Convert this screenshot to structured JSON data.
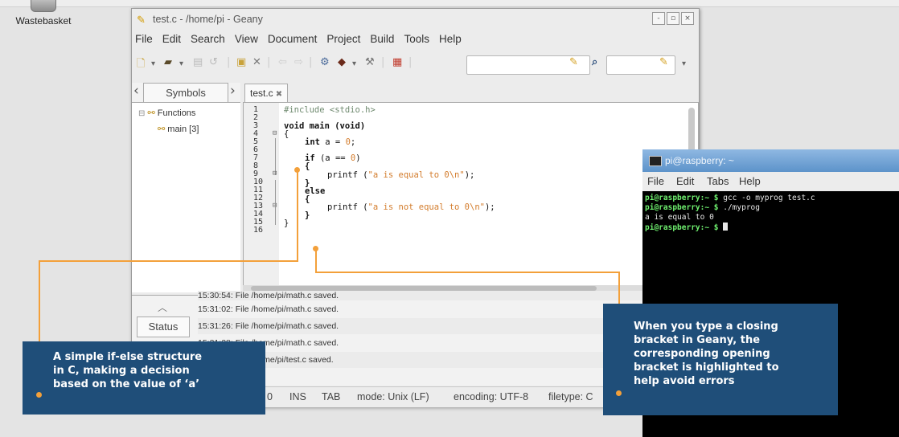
{
  "desktop": {
    "wastebasket_label": "Wastebasket"
  },
  "geany": {
    "title": "test.c - /home/pi - Geany",
    "window_buttons": [
      "-",
      "▫",
      "×"
    ],
    "menu": [
      "File",
      "Edit",
      "Search",
      "View",
      "Document",
      "Project",
      "Build",
      "Tools",
      "Help"
    ],
    "symbols_tab": "Symbols",
    "symbols_tree": {
      "group": "Functions",
      "item": "main [3]"
    },
    "editor_tab": "test.c",
    "editor_tab_close": "✖",
    "line_numbers": [
      "1",
      "2",
      "3",
      "4",
      "5",
      "6",
      "7",
      "8",
      "9",
      "10",
      "11",
      "12",
      "13",
      "14",
      "15",
      "16"
    ],
    "code": {
      "l1": "#include <stdio.h>",
      "l3": "void main (void)",
      "l4": "{",
      "l5_kw": "int",
      "l5_rest": " a = ",
      "l5_num": "0",
      "l5_end": ";",
      "l7_kw": "if",
      "l7_rest": " (a == ",
      "l7_num": "0",
      "l7_end": ")",
      "l8": "{",
      "l9_fn": "printf (",
      "l9_str": "\"a is equal to 0\\n\"",
      "l9_end": ");",
      "l10": "}",
      "l11": "else",
      "l12": "{",
      "l13_fn": "printf (",
      "l13_str": "\"a is not equal to 0\\n\"",
      "l13_end": ");",
      "l14": "}",
      "l15": "}"
    },
    "status_tab": "Status",
    "messages": [
      "15:30:54: File /home/pi/math.c saved.",
      "15:31:02: File /home/pi/math.c saved.",
      "15:31:26: File /home/pi/math.c saved.",
      "15:31:28: File /home/pi/math.c saved.",
      "15:31:33: File /home/pi/test.c saved."
    ],
    "statusbar": {
      "col": "0",
      "ins": "INS",
      "tab": "TAB",
      "mode": "mode: Unix (LF)",
      "encoding": "encoding: UTF-8",
      "filetype": "filetype: C"
    }
  },
  "terminal": {
    "title": "pi@raspberry: ~",
    "menu": [
      "File",
      "Edit",
      "Tabs",
      "Help"
    ],
    "lines": [
      {
        "prompt": "pi@raspberry:~ $",
        "cmd": " gcc -o myprog test.c"
      },
      {
        "prompt": "pi@raspberry:~ $",
        "cmd": " ./myprog"
      },
      {
        "prompt": "",
        "cmd": "a is equal to 0"
      },
      {
        "prompt": "pi@raspberry:~ $",
        "cmd": " "
      }
    ]
  },
  "annotations": {
    "left": "A simple if-else structure\nin C, making a decision\nbased on the value of ‘a’",
    "right": "When you type a closing\nbracket in Geany, the\ncorresponding opening\nbracket is highlighted to\nhelp avoid errors"
  },
  "colors": {
    "callout_bg": "#1f4e79",
    "leader_line": "#f3a03a",
    "terminal_prompt": "#6ff06f",
    "string_literal": "#d37c2c"
  }
}
